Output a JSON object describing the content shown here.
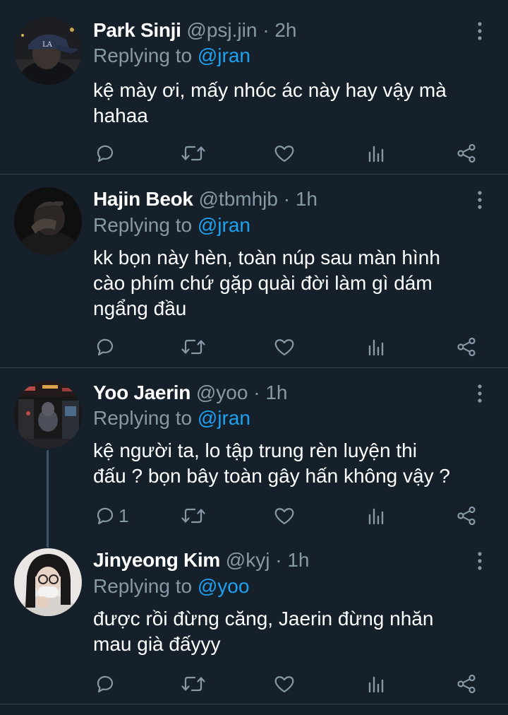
{
  "replies": [
    {
      "name": "Park Sinji",
      "handle": "@psj.jin",
      "dot": "·",
      "time": "2h",
      "replying_prefix": "Replying to",
      "replying_to": "@jran",
      "text_lines": [
        "kệ mày ơi, mấy nhóc ác này hay vậy mà",
        "hahaa"
      ],
      "reply_count": "",
      "avatar_icon": "avatar-cap-photo"
    },
    {
      "name": "Hajin Beok",
      "handle": "@tbmhjb",
      "dot": "·",
      "time": "1h",
      "replying_prefix": "Replying to",
      "replying_to": "@jran",
      "text_lines": [
        "kk bọn này hèn, toàn núp sau màn hình",
        "cào phím chứ gặp quài đời làm gì dám",
        "ngẩng đầu"
      ],
      "reply_count": "",
      "avatar_icon": "avatar-dark-photo"
    },
    {
      "name": "Yoo Jaerin",
      "handle": "@yoo",
      "dot": "·",
      "time": "1h",
      "replying_prefix": "Replying to",
      "replying_to": "@jran",
      "text_lines": [
        "kệ người ta, lo tập trung rèn luyện thi",
        "đấu ? bọn bây toàn gây hấn không vậy ?"
      ],
      "reply_count": "1",
      "avatar_icon": "avatar-arcade-photo"
    },
    {
      "name": "Jinyeong Kim",
      "handle": "@kyj",
      "dot": "·",
      "time": "1h",
      "replying_prefix": "Replying to",
      "replying_to": "@yoo",
      "text_lines": [
        "được rồi đừng căng, Jaerin đừng nhăn",
        "mau già đấyyy"
      ],
      "reply_count": "",
      "avatar_icon": "avatar-glasses-photo"
    }
  ],
  "icons": {
    "reply": "reply-icon",
    "retweet": "retweet-icon",
    "like": "heart-icon",
    "analytics": "analytics-icon",
    "share": "share-icon",
    "more": "more-vertical-icon"
  },
  "colors": {
    "background": "#15202b",
    "text": "#ffffff",
    "muted": "#8899a6",
    "link": "#1da1f2",
    "divider": "#38444d"
  }
}
